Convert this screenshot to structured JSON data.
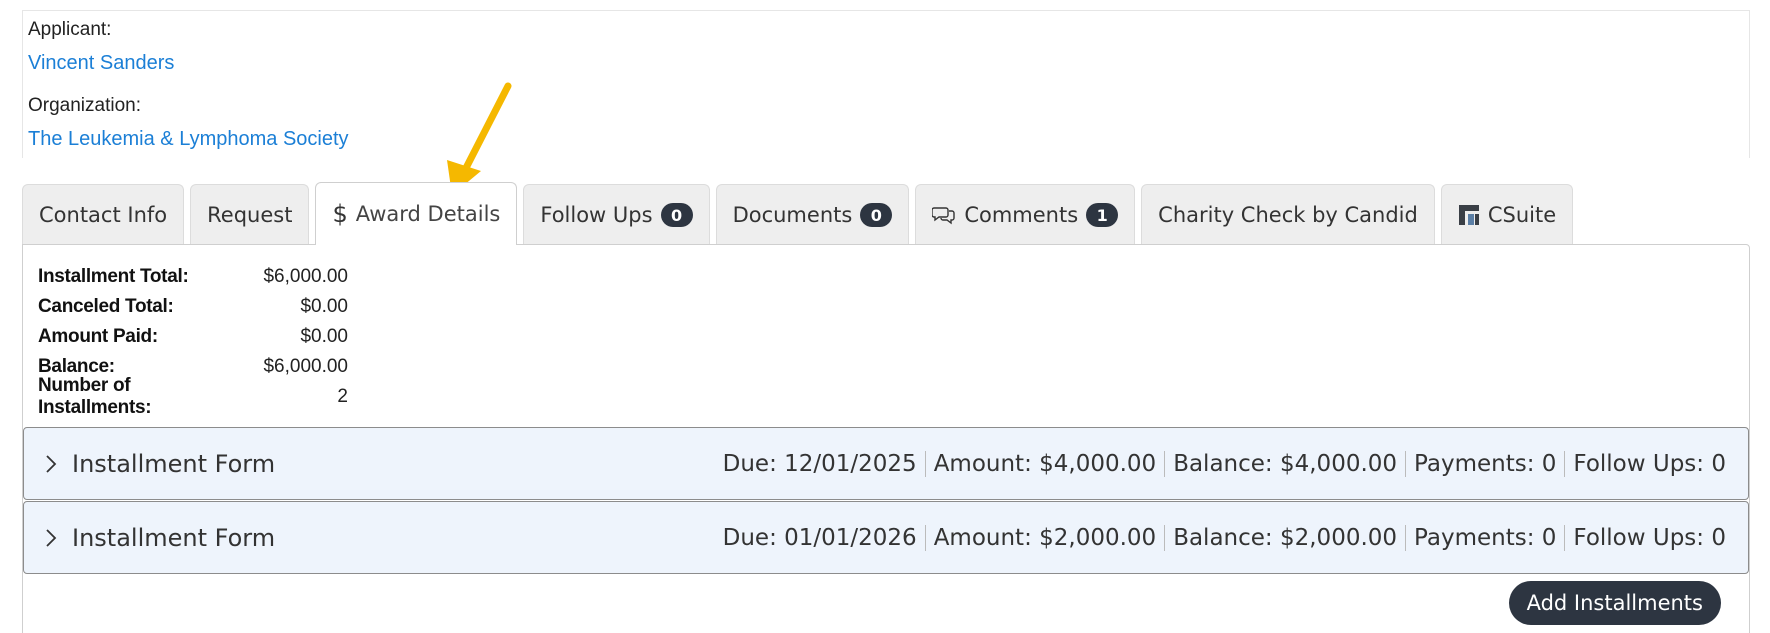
{
  "header": {
    "applicant_label": "Applicant:",
    "applicant_name": "Vincent Sanders",
    "organization_label": "Organization:",
    "organization_name": "The Leukemia & Lymphoma Society"
  },
  "tabs": [
    {
      "label": "Contact Info"
    },
    {
      "label": "Request"
    },
    {
      "label": "Award Details",
      "icon": "dollar-icon",
      "active": true
    },
    {
      "label": "Follow Ups",
      "badge": "0"
    },
    {
      "label": "Documents",
      "badge": "0"
    },
    {
      "label": "Comments",
      "badge": "1",
      "icon": "comments-icon"
    },
    {
      "label": "Charity Check by Candid"
    },
    {
      "label": "CSuite",
      "icon": "csuite-logo-icon"
    }
  ],
  "summary": [
    {
      "label": "Installment Total:",
      "value": "$6,000.00"
    },
    {
      "label": "Canceled Total:",
      "value": "$0.00"
    },
    {
      "label": "Amount Paid:",
      "value": "$0.00"
    },
    {
      "label": "Balance:",
      "value": "$6,000.00"
    },
    {
      "label": "Number of Installments:",
      "value": "2"
    }
  ],
  "installments": [
    {
      "title": "Installment Form",
      "due": "Due: 12/01/2025",
      "amount": "Amount: $4,000.00",
      "balance": "Balance: $4,000.00",
      "payments": "Payments: 0",
      "follow_ups": "Follow Ups: 0"
    },
    {
      "title": "Installment Form",
      "due": "Due: 01/01/2026",
      "amount": "Amount: $2,000.00",
      "balance": "Balance: $2,000.00",
      "payments": "Payments: 0",
      "follow_ups": "Follow Ups: 0"
    }
  ],
  "actions": {
    "add_installments_label": "Add Installments"
  },
  "colors": {
    "link": "#1b7fd6",
    "badge_bg": "#2d3541",
    "installment_bg": "#eef4fc",
    "annotation_arrow": "#f5b800"
  }
}
